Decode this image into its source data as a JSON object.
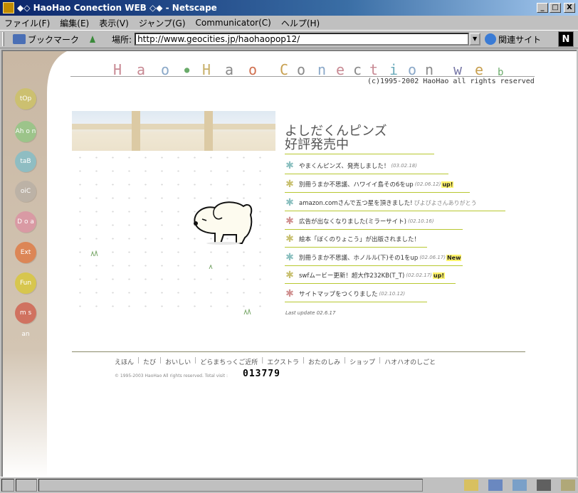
{
  "window": {
    "title": "◆◇ HaoHao Conection WEB ◇◆ - Netscape",
    "min_btn": "_",
    "max_btn": "□",
    "close_btn": "X"
  },
  "menu": {
    "file": "ファイル(F)",
    "edit": "編集(E)",
    "view": "表示(V)",
    "go": "ジャンプ(G)",
    "communicator": "Communicator(C)",
    "help": "ヘルプ(H)"
  },
  "toolbar": {
    "bookmarks_label": "ブックマーク",
    "location_label": "場所:",
    "url": "http://www.geocities.jp/haohaopop12/",
    "related_label": "関連サイト",
    "netscape_logo": "N"
  },
  "page": {
    "logo_letters": [
      {
        "ch": "H",
        "color": "#c88a94"
      },
      {
        "ch": "a",
        "color": "#c88a94"
      },
      {
        "ch": "o",
        "color": "#8aa8c8"
      },
      {
        "ch": "●",
        "color": "#6aab6a"
      },
      {
        "ch": "H",
        "color": "#c8b06a"
      },
      {
        "ch": "a",
        "color": "#8a8a8a"
      },
      {
        "ch": "o",
        "color": "#d07050"
      },
      {
        "ch": "C",
        "color": "#c8a050"
      },
      {
        "ch": "o",
        "color": "#8a8a8a"
      },
      {
        "ch": "n",
        "color": "#8aa8c8"
      },
      {
        "ch": "e",
        "color": "#c88a94"
      },
      {
        "ch": "c",
        "color": "#8a8a8a"
      },
      {
        "ch": "t",
        "color": "#c88a94"
      },
      {
        "ch": "i",
        "color": "#6aaaba"
      },
      {
        "ch": "o",
        "color": "#8aa8c8"
      },
      {
        "ch": "n",
        "color": "#8a8a8a"
      },
      {
        "ch": "w",
        "color": "#7a7aa8"
      },
      {
        "ch": "e",
        "color": "#c8a050"
      },
      {
        "ch": "b",
        "color": "#6aab6a"
      }
    ],
    "copyright_top": "(c)1995-2002 HaoHao all rights reserved",
    "nav": [
      {
        "label": "tOp",
        "color": "#ccc070"
      },
      {
        "label": "Ah o n",
        "color": "#9cc48a"
      },
      {
        "label": "taB",
        "color": "#8fbdc2"
      },
      {
        "label": "oiC",
        "color": "#bcb2a6"
      },
      {
        "label": "D o a",
        "color": "#d99aa4"
      },
      {
        "label": "Ext",
        "color": "#dc8656"
      },
      {
        "label": "Fun",
        "color": "#d7c64e"
      },
      {
        "label": "m s an",
        "color": "#d07260"
      }
    ],
    "news_title_1": "よしだくんピンズ",
    "news_title_2": "好評発売中",
    "news": [
      {
        "star_color": "#8abfbf",
        "text": "やまくんピンズ、発売しました！",
        "date": "(03.02.18)",
        "badge": "",
        "note": ""
      },
      {
        "star_color": "#c8c070",
        "text": "別冊うまか不思議、ハワイイ島その6をup",
        "date": "(02.06.12)",
        "badge": "up!",
        "note": ""
      },
      {
        "star_color": "#8abfbf",
        "text": "amazon.comさんで五つ星を頂きました!",
        "date": "",
        "badge": "",
        "note": "ぴよぴよさんありがとう"
      },
      {
        "star_color": "#d09090",
        "text": "広告が出なくなりました(ミラーサイト)",
        "date": "(02.10.16)",
        "badge": "",
        "note": ""
      },
      {
        "star_color": "#c8c070",
        "text": "絵本「ぼくのりょこう」が出版されました！",
        "date": "",
        "badge": "",
        "note": ""
      },
      {
        "star_color": "#8abfbf",
        "text": "別冊うまか不思議、ホノルル(下)その1をup",
        "date": "(02.06.17)",
        "badge": "New",
        "note": ""
      },
      {
        "star_color": "#c8c070",
        "text": "swfムービー更新！超大作232KB(T_T)",
        "date": "(02.02.17)",
        "badge": "up!",
        "note": ""
      },
      {
        "star_color": "#d09090",
        "text": "サイトマップをつくりました",
        "date": "(02.10.12)",
        "badge": "",
        "note": ""
      }
    ],
    "last_update": "Last update 02.6.17",
    "footer_nav": [
      "えほん",
      "たび",
      "おいしい",
      "どらまちっくご近所",
      "エクストラ",
      "おたのしみ",
      "ショップ",
      "ハオハオのしごと"
    ],
    "footer_copy": "© 1995-2003 HaoHao All rights reserved. Total visit :",
    "counter": "013779"
  }
}
